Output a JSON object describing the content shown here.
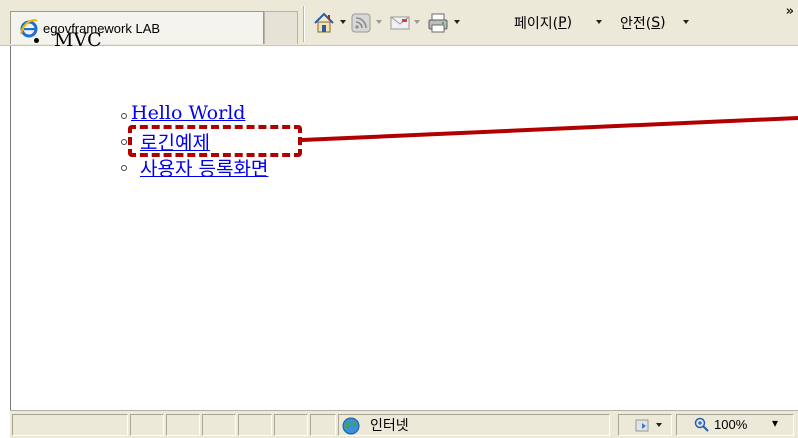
{
  "browser": {
    "tab_title": "egovframework LAB",
    "page_menu_label": "페이지(",
    "page_menu_key": "P",
    "page_menu_suffix": ")",
    "safety_menu_label": "안전(",
    "safety_menu_key": "S",
    "safety_menu_suffix": ")",
    "chevron": "»",
    "icons": [
      "ie-logo-icon",
      "home-icon",
      "feeds-icon",
      "mail-icon",
      "print-icon"
    ]
  },
  "page": {
    "outer_item": "MVC",
    "links": [
      "Hello World",
      "로긴예제",
      "사용자 등록화면"
    ],
    "highlight_color": "#b00000"
  },
  "status": {
    "zone": "인터넷",
    "zoom": "100%",
    "zoom_arrow": "▾"
  }
}
